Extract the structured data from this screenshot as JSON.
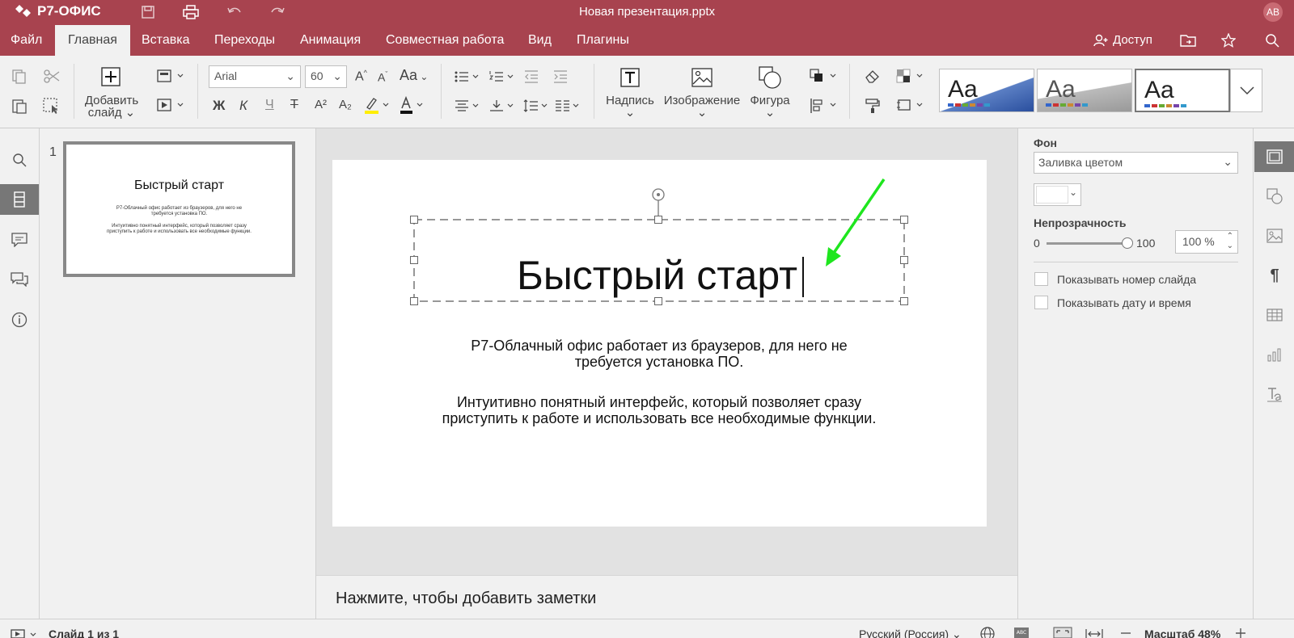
{
  "app": {
    "brand": "Р7-ОФИС",
    "title": "Новая презентация.pptx",
    "avatar": "АВ"
  },
  "menu": {
    "items": [
      "Файл",
      "Главная",
      "Вставка",
      "Переходы",
      "Анимация",
      "Совместная работа",
      "Вид",
      "Плагины"
    ],
    "active": "Главная",
    "access": "Доступ"
  },
  "toolbar": {
    "add_slide_line1": "Добавить",
    "add_slide_line2": "слайд",
    "font_name": "Arial",
    "font_size": "60",
    "bold": "Ж",
    "italic": "К",
    "underline": "Ч",
    "strike": "Т",
    "superscript": "A²",
    "subscript": "A₂",
    "change_case": "Aa",
    "text_box": "Надпись",
    "image": "Изображение",
    "shape": "Фигура",
    "theme_sample": "Aa"
  },
  "slides_panel": {
    "number": "1"
  },
  "slide": {
    "title": "Быстрый старт",
    "paragraph1_line1": "Р7-Облачный офис работает из браузеров, для него не",
    "paragraph1_line2": "требуется установка ПО.",
    "paragraph2_line1": "Интуитивно понятный интерфейс, который позволяет сразу",
    "paragraph2_line2": "приступить к работе и использовать все необходимые функции."
  },
  "notes": {
    "placeholder": "Нажмите, чтобы добавить заметки"
  },
  "right_panel": {
    "background_label": "Фон",
    "fill_type": "Заливка цветом",
    "opacity_label": "Непрозрачность",
    "opacity_min": "0",
    "opacity_max": "100",
    "opacity_value": "100 %",
    "opacity_level": 1.0,
    "show_slide_number": "Показывать номер слайда",
    "show_date_time": "Показывать дату и время"
  },
  "status": {
    "slide_counter": "Слайд 1 из 1",
    "language": "Русский (Россия)",
    "zoom": "Масштаб 48%"
  },
  "colors": {
    "brand": "#a8434f",
    "annotation_arrow": "#1ee61e",
    "background": "#f1f1f1"
  }
}
